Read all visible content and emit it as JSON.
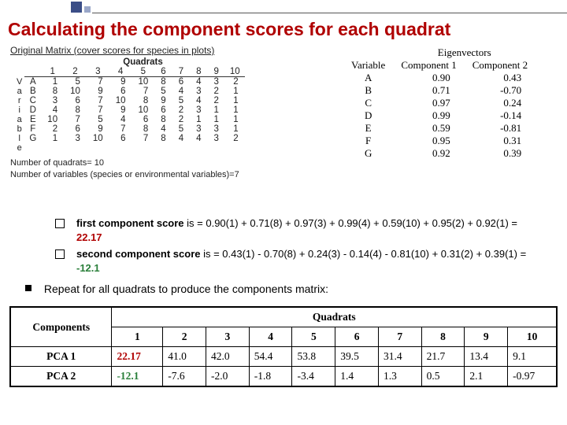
{
  "title": "Calculating the component scores for each quadrat",
  "original_matrix": {
    "caption": "Original Matrix (cover scores for species in plots)",
    "group_label": "Quadrats",
    "side_label": "Variables",
    "col_indices": [
      "1",
      "2",
      "3",
      "4",
      "5",
      "6",
      "7",
      "8",
      "9",
      "10"
    ],
    "rows": [
      {
        "v": "V",
        "s": "A",
        "vals": [
          1,
          5,
          7,
          9,
          10,
          8,
          6,
          4,
          3,
          2
        ]
      },
      {
        "v": "a",
        "s": "B",
        "vals": [
          8,
          10,
          9,
          6,
          7,
          5,
          4,
          3,
          2,
          1
        ]
      },
      {
        "v": "r",
        "s": "C",
        "vals": [
          3,
          6,
          7,
          10,
          8,
          9,
          5,
          4,
          2,
          1
        ]
      },
      {
        "v": "i",
        "s": "D",
        "vals": [
          4,
          8,
          7,
          9,
          10,
          6,
          2,
          3,
          1,
          1
        ]
      },
      {
        "v": "a",
        "s": "E",
        "vals": [
          10,
          7,
          5,
          4,
          6,
          8,
          2,
          1,
          1,
          1
        ]
      },
      {
        "v": "b",
        "s": "F",
        "vals": [
          2,
          6,
          9,
          7,
          8,
          4,
          5,
          3,
          3,
          1
        ]
      },
      {
        "v": "l",
        "s": "G",
        "vals": [
          1,
          3,
          10,
          6,
          7,
          8,
          4,
          4,
          3,
          2
        ]
      },
      {
        "v": "e",
        "s": "",
        "vals": []
      }
    ],
    "foot1": "Number of quadrats= 10",
    "foot2": "Number of variables (species or environmental variables)=7"
  },
  "eigen": {
    "super": "Eigenvectors",
    "head": [
      "Variable",
      "Component 1",
      "Component 2"
    ],
    "rows": [
      [
        "A",
        "0.90",
        "0.43"
      ],
      [
        "B",
        "0.71",
        "-0.70"
      ],
      [
        "C",
        "0.97",
        "0.24"
      ],
      [
        "D",
        "0.99",
        "-0.14"
      ],
      [
        "E",
        "0.59",
        "-0.81"
      ],
      [
        "F",
        "0.95",
        "0.31"
      ],
      [
        "G",
        "0.92",
        "0.39"
      ]
    ]
  },
  "bullet1": {
    "lead": "first component score",
    "mid": " is = 0.90(1) + 0.71(8) + 0.97(3) + 0.99(4) + 0.59(10) + 0.95(2) + 0.92(1) = ",
    "val": "22.17"
  },
  "bullet2": {
    "lead": "second component score",
    "mid": " is = 0.43(1) - 0.70(8) + 0.24(3) - 0.14(4) - 0.81(10) + 0.31(2) + 0.39(1) = ",
    "val": "-12.1"
  },
  "repeat_line": "Repeat for all quadrats to produce the components matrix:",
  "components_table": {
    "corner": "Components",
    "super": "Quadrats",
    "cols": [
      "1",
      "2",
      "3",
      "4",
      "5",
      "6",
      "7",
      "8",
      "9",
      "10"
    ],
    "rows": [
      {
        "name": "PCA 1",
        "first": "22.17",
        "vals": [
          "41.0",
          "42.0",
          "54.4",
          "53.8",
          "39.5",
          "31.4",
          "21.7",
          "13.4",
          "9.1"
        ]
      },
      {
        "name": "PCA 2",
        "first": "-12.1",
        "vals": [
          "-7.6",
          "-2.0",
          "-1.8",
          "-3.4",
          "1.4",
          "1.3",
          "0.5",
          "2.1",
          "-0.97"
        ]
      }
    ]
  },
  "chart_data": {
    "type": "table",
    "title": "Calculating the component scores for each quadrat",
    "original_matrix": {
      "quadrats": [
        1,
        2,
        3,
        4,
        5,
        6,
        7,
        8,
        9,
        10
      ],
      "species": [
        "A",
        "B",
        "C",
        "D",
        "E",
        "F",
        "G"
      ],
      "values": [
        [
          1,
          5,
          7,
          9,
          10,
          8,
          6,
          4,
          3,
          2
        ],
        [
          8,
          10,
          9,
          6,
          7,
          5,
          4,
          3,
          2,
          1
        ],
        [
          3,
          6,
          7,
          10,
          8,
          9,
          5,
          4,
          2,
          1
        ],
        [
          4,
          8,
          7,
          9,
          10,
          6,
          2,
          3,
          1,
          1
        ],
        [
          10,
          7,
          5,
          4,
          6,
          8,
          2,
          1,
          1,
          1
        ],
        [
          2,
          6,
          9,
          7,
          8,
          4,
          5,
          3,
          3,
          1
        ],
        [
          1,
          3,
          10,
          6,
          7,
          8,
          4,
          4,
          3,
          2
        ]
      ],
      "n_quadrats": 10,
      "n_variables": 7
    },
    "eigenvectors": {
      "variables": [
        "A",
        "B",
        "C",
        "D",
        "E",
        "F",
        "G"
      ],
      "component_1": [
        0.9,
        0.71,
        0.97,
        0.99,
        0.59,
        0.95,
        0.92
      ],
      "component_2": [
        0.43,
        -0.7,
        0.24,
        -0.14,
        -0.81,
        0.31,
        0.39
      ]
    },
    "component_scores": {
      "quadrats": [
        1,
        2,
        3,
        4,
        5,
        6,
        7,
        8,
        9,
        10
      ],
      "PCA1": [
        22.17,
        41.0,
        42.0,
        54.4,
        53.8,
        39.5,
        31.4,
        21.7,
        13.4,
        9.1
      ],
      "PCA2": [
        -12.1,
        -7.6,
        -2.0,
        -1.8,
        -3.4,
        1.4,
        1.3,
        0.5,
        2.1,
        -0.97
      ]
    }
  }
}
